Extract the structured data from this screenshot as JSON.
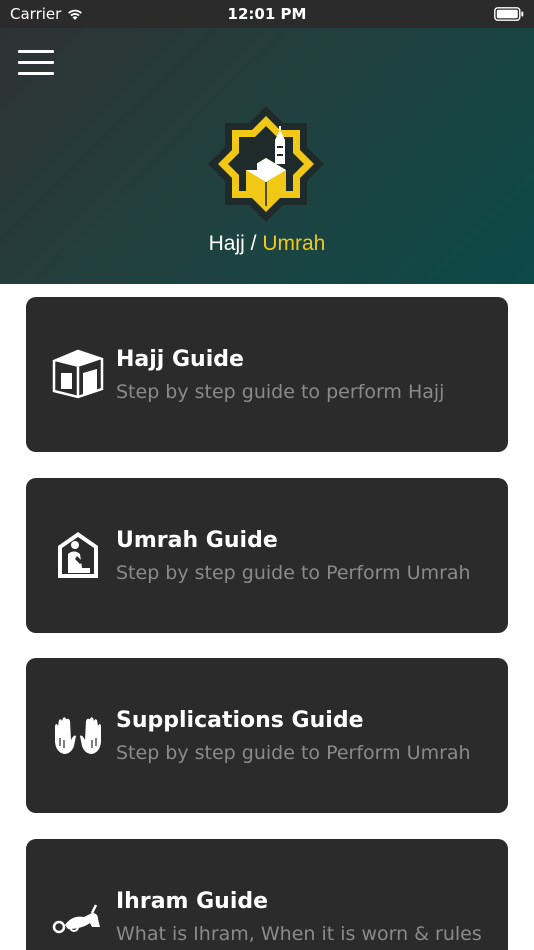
{
  "status_bar": {
    "carrier": "Carrier",
    "time": "12:01 PM"
  },
  "header": {
    "title_part1": "Hajj / ",
    "title_part2": "Umrah"
  },
  "colors": {
    "accent": "#f2c817",
    "card_bg": "#2b2b2b",
    "subtitle": "#8a8a8a"
  },
  "cards": [
    {
      "title": "Hajj Guide",
      "subtitle": "Step by step guide to perform Hajj",
      "icon": "kaaba-icon"
    },
    {
      "title": "Umrah Guide",
      "subtitle": "Step by step guide to Perform Umrah",
      "icon": "praying-person-icon"
    },
    {
      "title": "Supplications Guide",
      "subtitle": "Step by step guide to Perform Umrah",
      "icon": "praying-hands-icon"
    },
    {
      "title": "Ihram Guide",
      "subtitle": "What is Ihram, When it is worn & rules",
      "icon": "prostrating-person-icon"
    }
  ]
}
